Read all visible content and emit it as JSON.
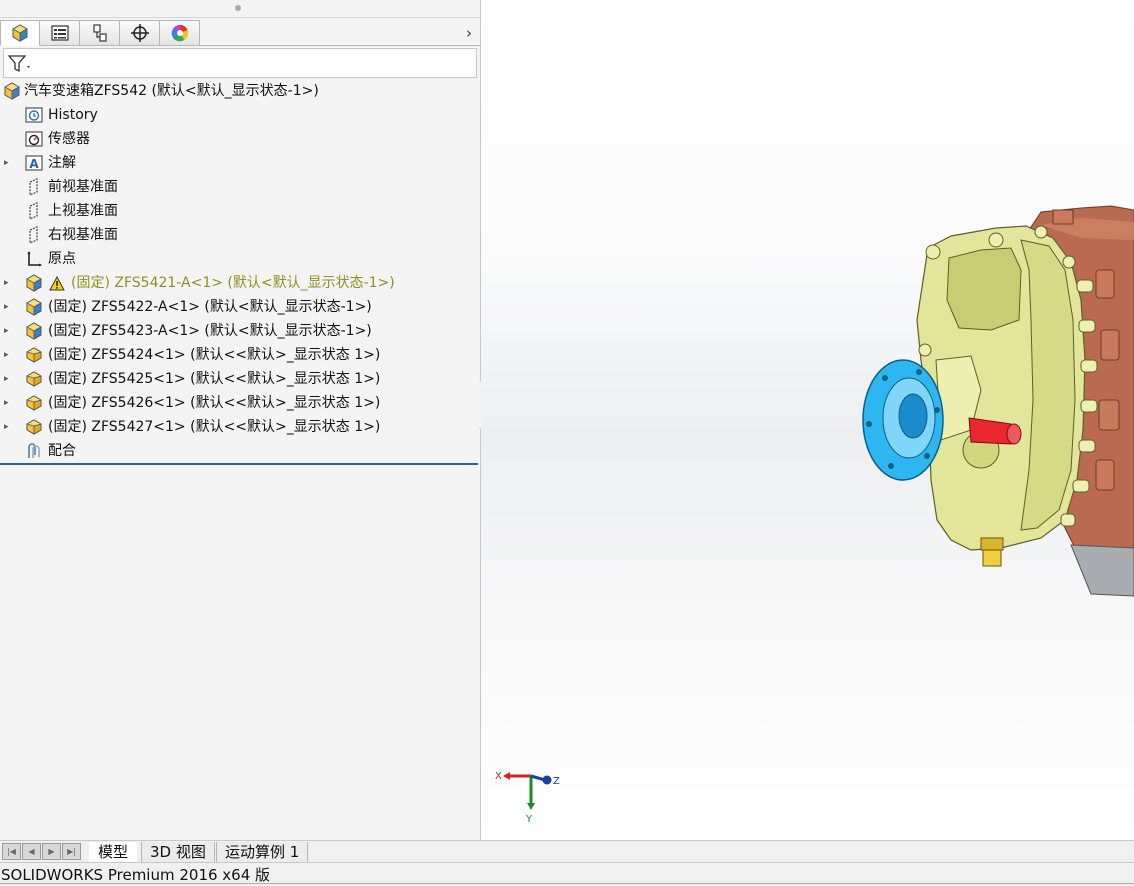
{
  "feature_manager": {
    "tabs": [
      {
        "icon": "feature-manager-tab-icon"
      },
      {
        "icon": "property-manager-tab-icon"
      },
      {
        "icon": "configuration-manager-tab-icon"
      },
      {
        "icon": "dimxpert-manager-tab-icon"
      },
      {
        "icon": "display-manager-tab-icon"
      }
    ],
    "more_glyph": "›",
    "tree": {
      "root": "汽车变速箱ZFS542  (默认<默认_显示状态-1>)",
      "items": [
        {
          "label": "History",
          "icon": "history-icon",
          "expandable": false
        },
        {
          "label": "传感器",
          "icon": "sensor-icon",
          "expandable": false
        },
        {
          "label": "注解",
          "icon": "annotation-icon",
          "expandable": true
        },
        {
          "label": "前视基准面",
          "icon": "plane-icon",
          "expandable": false
        },
        {
          "label": "上视基准面",
          "icon": "plane-icon",
          "expandable": false
        },
        {
          "label": "右视基准面",
          "icon": "plane-icon",
          "expandable": false
        },
        {
          "label": "原点",
          "icon": "origin-icon",
          "expandable": false
        },
        {
          "label": "(固定) ZFS5421-A<1> (默认<默认_显示状态-1>)",
          "icon": "subassembly-icon",
          "expandable": true,
          "warning": true
        },
        {
          "label": "(固定) ZFS5422-A<1> (默认<默认_显示状态-1>)",
          "icon": "subassembly-icon",
          "expandable": true
        },
        {
          "label": "(固定) ZFS5423-A<1> (默认<默认_显示状态-1>)",
          "icon": "subassembly-icon",
          "expandable": true
        },
        {
          "label": "(固定) ZFS5424<1> (默认<<默认>_显示状态 1>)",
          "icon": "part-icon",
          "expandable": true
        },
        {
          "label": "(固定) ZFS5425<1> (默认<<默认>_显示状态 1>)",
          "icon": "part-icon",
          "expandable": true
        },
        {
          "label": "(固定) ZFS5426<1> (默认<<默认>_显示状态 1>)",
          "icon": "part-icon",
          "expandable": true
        },
        {
          "label": "(固定) ZFS5427<1> (默认<<默认>_显示状态 1>)",
          "icon": "part-icon",
          "expandable": true
        },
        {
          "label": "配合",
          "icon": "mates-icon",
          "expandable": false
        }
      ]
    }
  },
  "triad": {
    "x": "X",
    "y": "Y",
    "z": "Z"
  },
  "colors": {
    "housing": "#e3e59a",
    "flange": "#2db6ef",
    "shaft": "#e8282e",
    "rear_case": "#b96a50",
    "plug": "#f0d040"
  },
  "bottom_tabs": [
    {
      "label": "模型",
      "active": true
    },
    {
      "label": "3D 视图",
      "active": false
    },
    {
      "label": "运动算例 1",
      "active": false
    }
  ],
  "status_bar": {
    "text": "SOLIDWORKS Premium 2016 x64 版"
  }
}
